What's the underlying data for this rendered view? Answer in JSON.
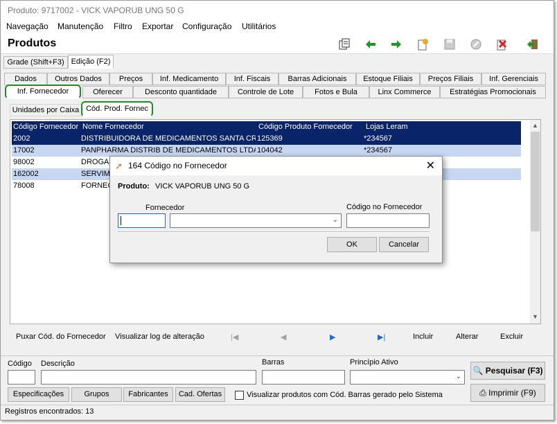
{
  "window": {
    "title": "Produto: 9717002 - VICK VAPORUB UNG 50 G"
  },
  "menu": [
    "Navegação",
    "Manutenção",
    "Filtro",
    "Exportar",
    "Configuração",
    "Utilitários"
  ],
  "header": {
    "title": "Produtos"
  },
  "view_tabs": [
    "Grade (Shift+F3)",
    "Edição (F2)"
  ],
  "tabs_row1": [
    "Dados",
    "Outros Dados",
    "Preços",
    "Inf. Medicamento",
    "Inf. Fiscais",
    "Barras Adicionais",
    "Estoque Filiais",
    "Preços Filiais",
    "Inf. Gerenciais"
  ],
  "tabs_row2": [
    "Inf. Fornecedor",
    "Oferecer",
    "Desconto quantidade",
    "Controle de Lote",
    "Fotos e Bula",
    "Linx Commerce",
    "Estratégias Promocionais"
  ],
  "sub_tabs": [
    "Unidades por Caixa",
    "Cód. Prod. Fornec"
  ],
  "grid": {
    "columns": [
      "Código Fornecedor",
      "Nome Fornecedor",
      "Código Produto Fornecedor",
      "Lojas Leram"
    ],
    "rows": [
      [
        "2002",
        "DISTRIBUIDORA DE MEDICAMENTOS SANTA CRUZ LTDA",
        "125369",
        "*234567"
      ],
      [
        "17002",
        "PANPHARMA DISTRIB DE MEDICAMENTOS LTDA",
        "104042",
        "*234567"
      ],
      [
        "98002",
        "DROGA",
        "",
        ""
      ],
      [
        "162002",
        "SERVIME",
        "",
        ""
      ],
      [
        "78008",
        "FORNECE",
        "",
        ""
      ]
    ]
  },
  "grid_actions": {
    "pull": "Puxar Cód. do Fornecedor",
    "log": "Visualizar log de alteração",
    "include": "Incluir",
    "edit": "Alterar",
    "delete": "Excluir"
  },
  "search": {
    "code_label": "Código",
    "desc_label": "Descrição",
    "barcode_label": "Barras",
    "active_label": "Princípio Ativo",
    "search_button": "Pesquisar (F3)",
    "print_button": "Imprimir (F9)",
    "buttons": [
      "Especificações",
      "Grupos",
      "Fabricantes",
      "Cad. Ofertas"
    ],
    "checkbox_label": "Visualizar produtos com Cód. Barras gerado pelo Sistema"
  },
  "status": {
    "records": "Registros encontrados: 13"
  },
  "dialog": {
    "title": "164 Código no Fornecedor",
    "product_label": "Produto:",
    "product_value": "VICK VAPORUB UNG 50 G",
    "supplier_label": "Fornecedor",
    "code_label": "Código no Fornecedor",
    "ok": "OK",
    "cancel": "Cancelar"
  },
  "colors": {
    "selected_row": "#0a246a",
    "alt_row": "#c7d7f2",
    "grid_header": "#0a246a",
    "highlight": "#228b22"
  }
}
